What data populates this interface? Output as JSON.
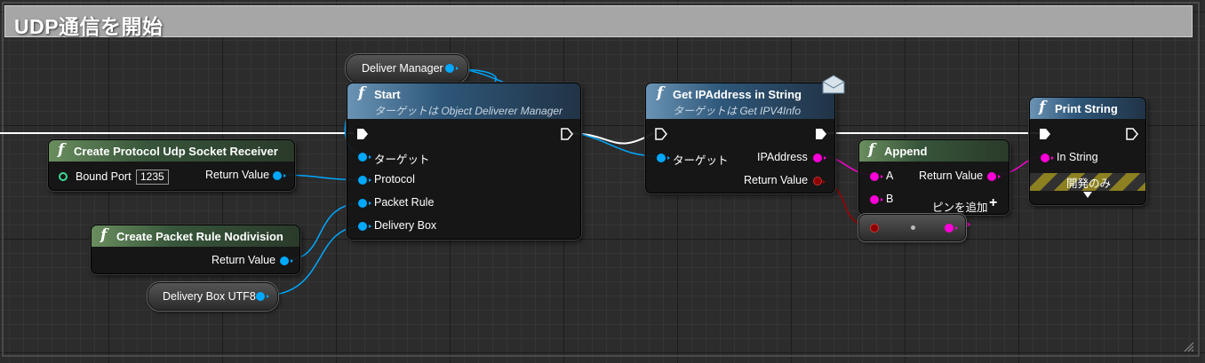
{
  "comment": {
    "title": "UDP通信を開始"
  },
  "nodes": {
    "create_udp": {
      "title": "Create Protocol Udp Socket Receiver",
      "bound_port_label": "Bound Port",
      "bound_port_value": "1235",
      "return_label": "Return Value"
    },
    "create_rule": {
      "title": "Create Packet Rule Nodivision",
      "return_label": "Return Value"
    },
    "delivery_box": {
      "label": "Delivery Box UTF8"
    },
    "deliver_manager": {
      "label": "Deliver Manager"
    },
    "start": {
      "title": "Start",
      "subtitle": "ターゲットは Object Deliverer Manager",
      "pins": [
        "ターゲット",
        "Protocol",
        "Packet Rule",
        "Delivery Box"
      ]
    },
    "get_ip": {
      "title": "Get IPAddress in String",
      "subtitle": "ターゲットは Get IPV4Info",
      "target_label": "ターゲット",
      "out_ip": "IPAddress",
      "out_return": "Return Value"
    },
    "append": {
      "title": "Append",
      "pin_a": "A",
      "pin_b": "B",
      "return_label": "Return Value",
      "add_pin_label": "ピンを追加"
    },
    "print": {
      "title": "Print String",
      "in_label": "In String",
      "dev_only_label": "開発のみ"
    }
  },
  "colors": {
    "object_pin": "#00a8ff",
    "string_pin": "#ff00d8",
    "bool_pin": "#8c0000",
    "int_pin": "#3ddc97",
    "exec_wire": "#ffffff"
  }
}
